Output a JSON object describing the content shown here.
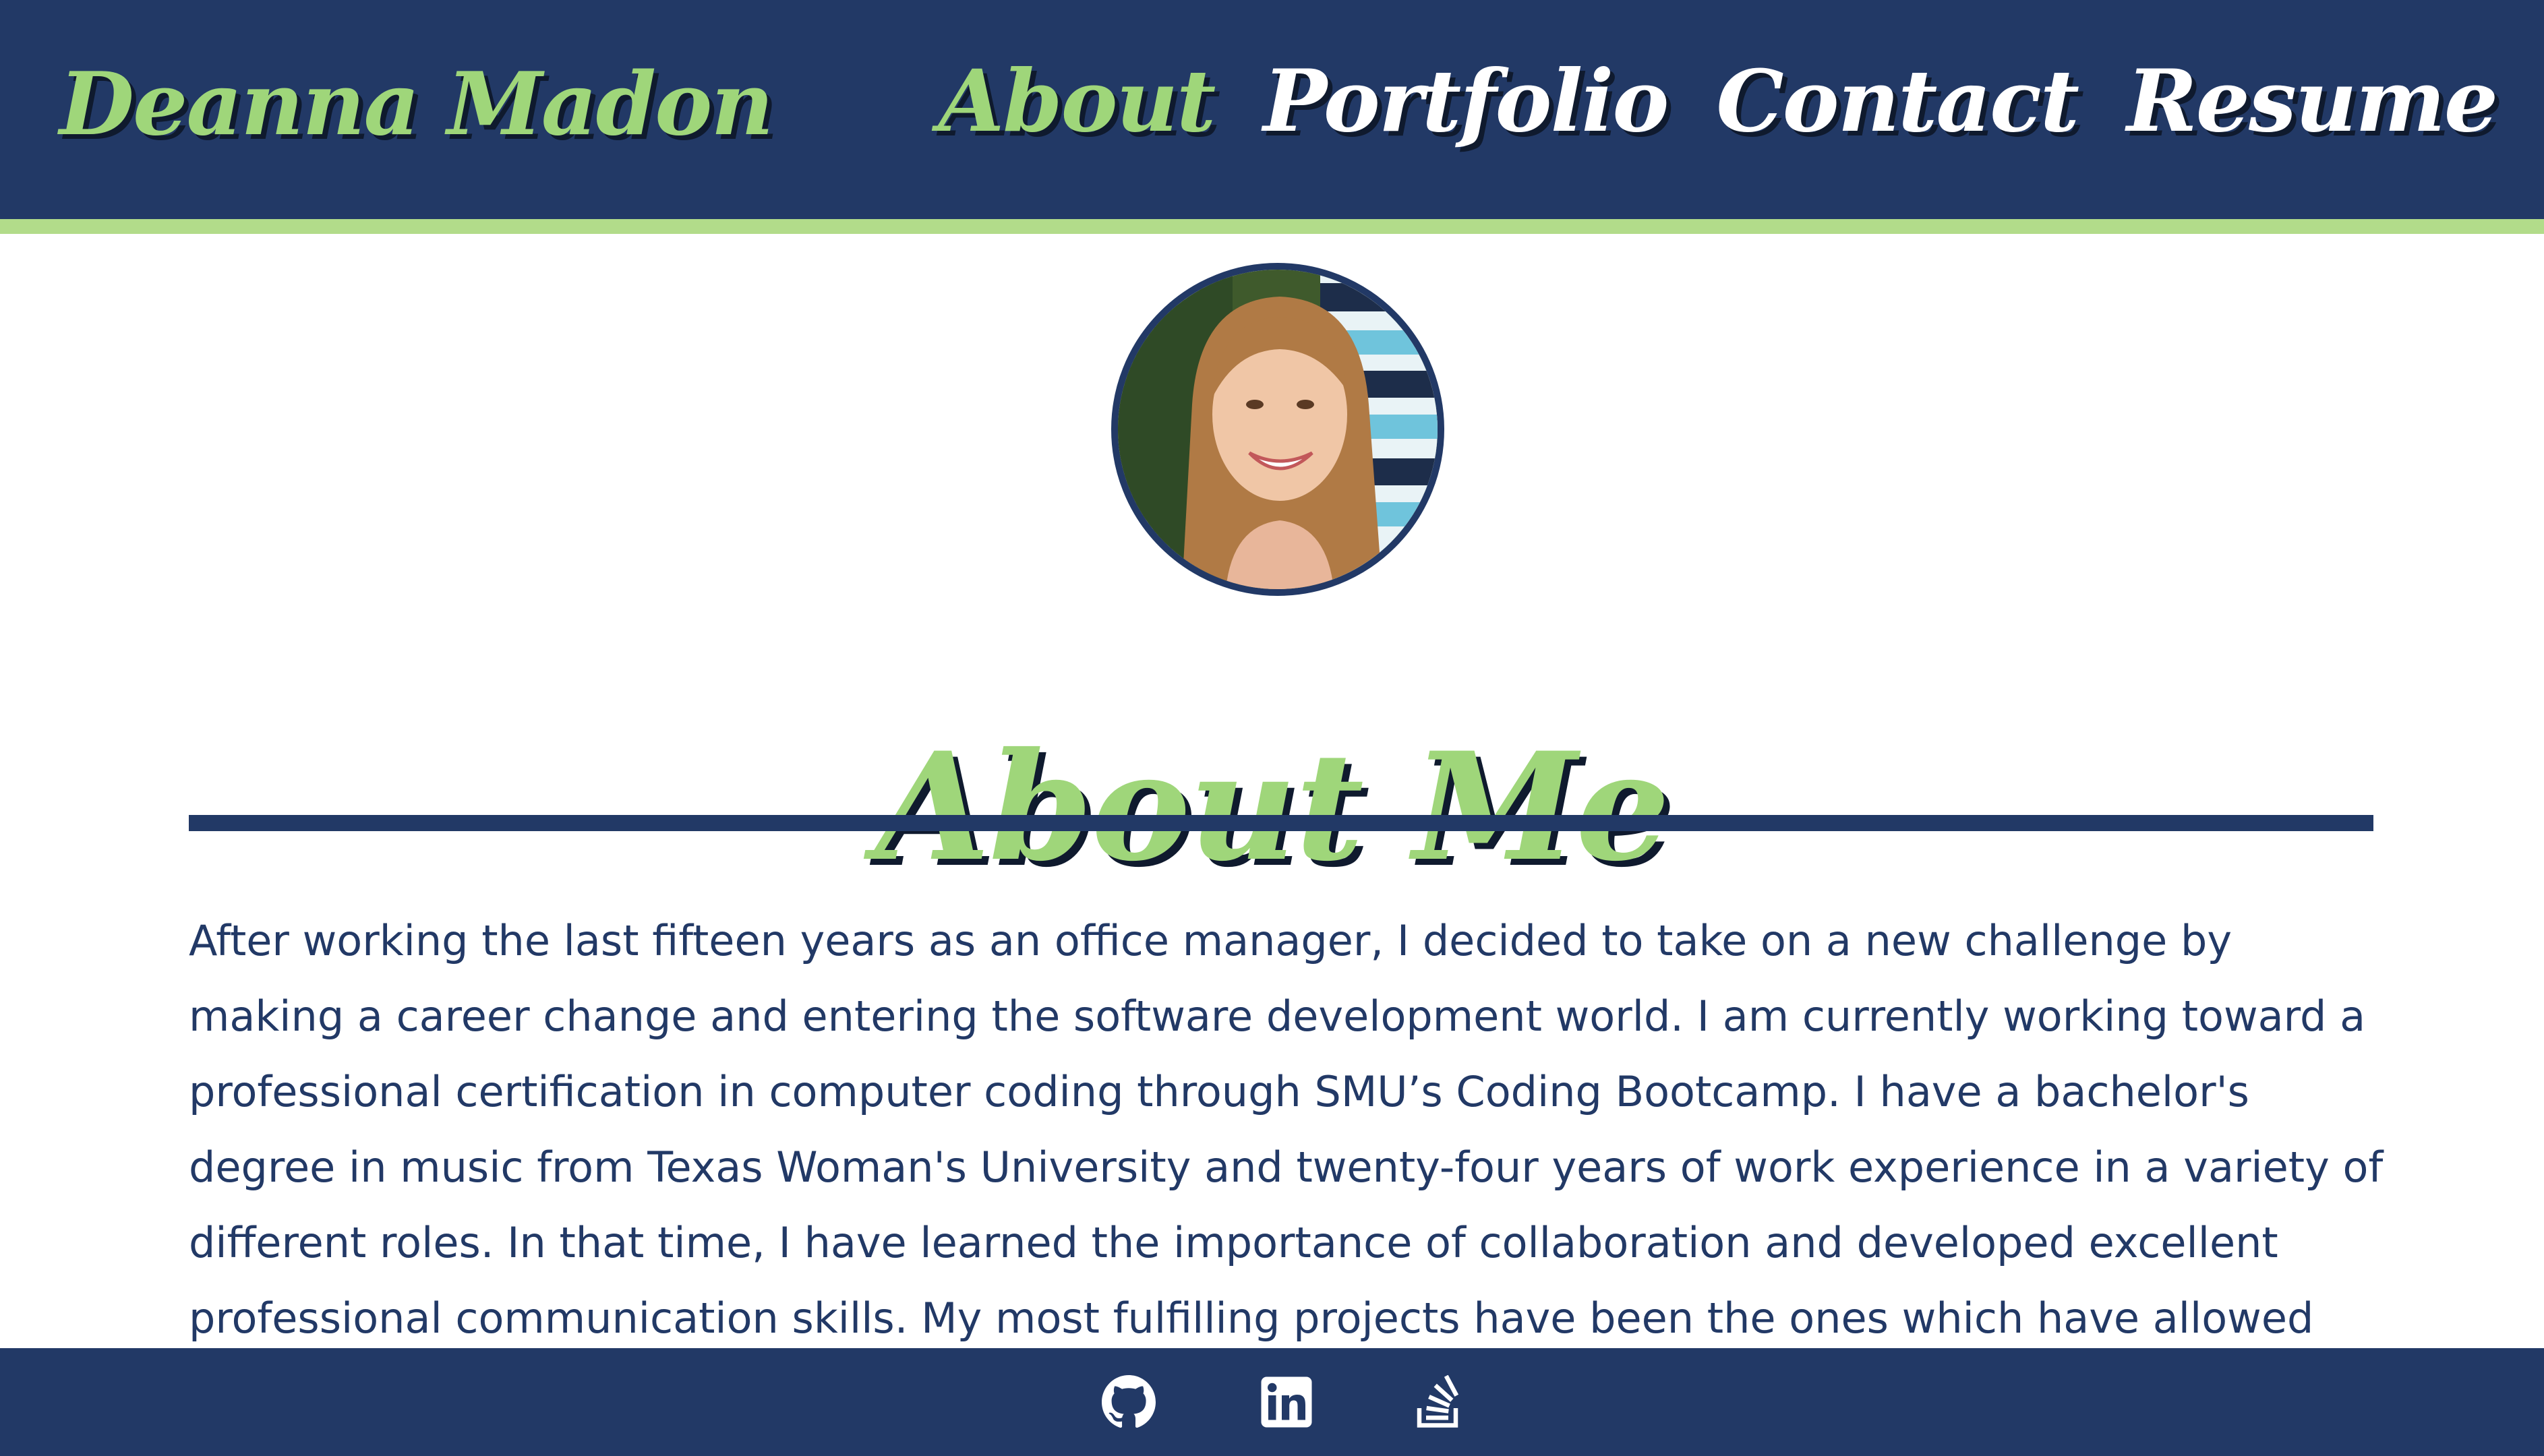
{
  "header": {
    "brand": "Deanna Madon",
    "nav": [
      {
        "label": "About",
        "active": true
      },
      {
        "label": "Portfolio",
        "active": false
      },
      {
        "label": "Contact",
        "active": false
      },
      {
        "label": "Resume",
        "active": false
      }
    ]
  },
  "main": {
    "heading": "About Me",
    "bio": "After working the last fifteen years as an office manager, I decided to take on a new challenge by making a career change and entering the software development world. I am currently working toward a professional certification in computer coding through SMU’s Coding Bootcamp. I have a bachelor's degree in music from Texas Woman's University and twenty-four years of work experience in a variety of different roles. In that time, I have learned the importance of collaboration and developed excellent professional communication skills. My most fulfilling projects have been the ones which have allowed"
  },
  "footer": {
    "icons": [
      "github-icon",
      "linkedin-icon",
      "stack-overflow-icon"
    ]
  },
  "colors": {
    "navy": "#223966",
    "accent_green": "#9fd67a",
    "stripe_green": "#b2dc8a",
    "white": "#ffffff"
  }
}
